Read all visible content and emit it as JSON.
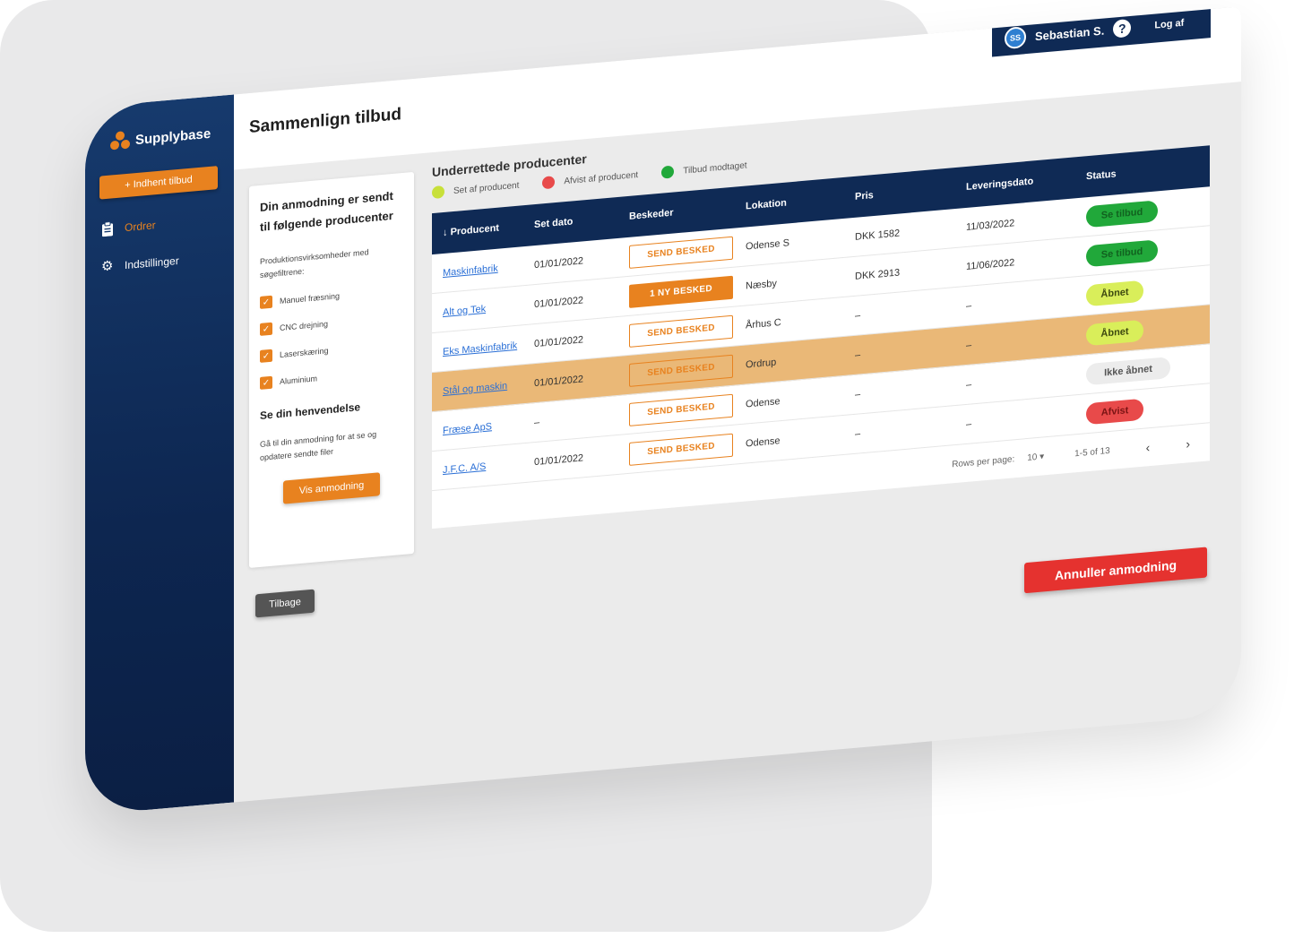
{
  "app": {
    "logo_text": "Supplybase"
  },
  "sidebar": {
    "new_button": "+ Indhent tilbud",
    "items": [
      {
        "label": "Ordrer",
        "icon": "clipboard-icon",
        "active": true
      },
      {
        "label": "Indstillinger",
        "icon": "gear-icon",
        "active": false
      }
    ]
  },
  "header": {
    "title": "Sammenlign tilbud",
    "user_initials": "SS",
    "user_name": "Sebastian S.",
    "help_icon": "?",
    "logout": "Log af"
  },
  "panel": {
    "heading": "Din anmodning er sendt til følgende producenter",
    "filter_intro": "Produktionsvirksomheder med søgefiltrene:",
    "filters": [
      "Manuel fræsning",
      "CNC drejning",
      "Laserskæring",
      "Aluminium"
    ],
    "section2_heading": "Se din henvendelse",
    "section2_text": "Gå til din anmodning for at se og opdatere sendte filer",
    "view_button": "Vis anmodning"
  },
  "back_button": "Tilbage",
  "producers": {
    "title": "Underrettede producenter",
    "legend": [
      {
        "label": "Set af producent",
        "color": "#c8e03a"
      },
      {
        "label": "Afvist af producent",
        "color": "#e84a4a"
      },
      {
        "label": "Tilbud modtaget",
        "color": "#21a83a"
      }
    ],
    "columns": {
      "producer": "Producent",
      "seen_date": "Set dato",
      "messages": "Beskeder",
      "location": "Lokation",
      "price": "Pris",
      "delivery": "Leveringsdato",
      "status": "Status"
    },
    "sort_icon": "↓",
    "rows": [
      {
        "producer": "Maskinfabrik",
        "seen_date": "01/01/2022",
        "message": "SEND BESKED",
        "location": "Odense S",
        "price": "DKK 1582",
        "delivery": "11/03/2022",
        "status": "Se tilbud"
      },
      {
        "producer": "Alt og Tek",
        "seen_date": "01/01/2022",
        "message": "1 NY BESKED",
        "location": "Næsby",
        "price": "DKK 2913",
        "delivery": "11/06/2022",
        "status": "Se tilbud"
      },
      {
        "producer": "Eks Maskinfabrik",
        "seen_date": "01/01/2022",
        "message": "SEND BESKED",
        "location": "Århus C",
        "price": "–",
        "delivery": "–",
        "status": "Åbnet"
      },
      {
        "producer": "Stål og maskin",
        "seen_date": "01/01/2022",
        "message": "SEND BESKED",
        "location": "Ordrup",
        "price": "–",
        "delivery": "–",
        "status": "Åbnet"
      },
      {
        "producer": "Fræse ApS",
        "seen_date": "–",
        "message": "SEND BESKED",
        "location": "Odense",
        "price": "–",
        "delivery": "–",
        "status": "Ikke åbnet"
      },
      {
        "producer": "J.F.C. A/S",
        "seen_date": "01/01/2022",
        "message": "SEND BESKED",
        "location": "Odense",
        "price": "–",
        "delivery": "–",
        "status": "Afvist"
      }
    ],
    "pagination": {
      "rows_per_page_label": "Rows per page:",
      "rows_per_page": "10",
      "range": "1-5 of 13",
      "prev": "‹",
      "next": "›"
    }
  },
  "cancel_button": "Annuller anmodning",
  "colors": {
    "brand_orange": "#e8821f",
    "navy": "#0f2a55",
    "danger": "#e5322f"
  }
}
